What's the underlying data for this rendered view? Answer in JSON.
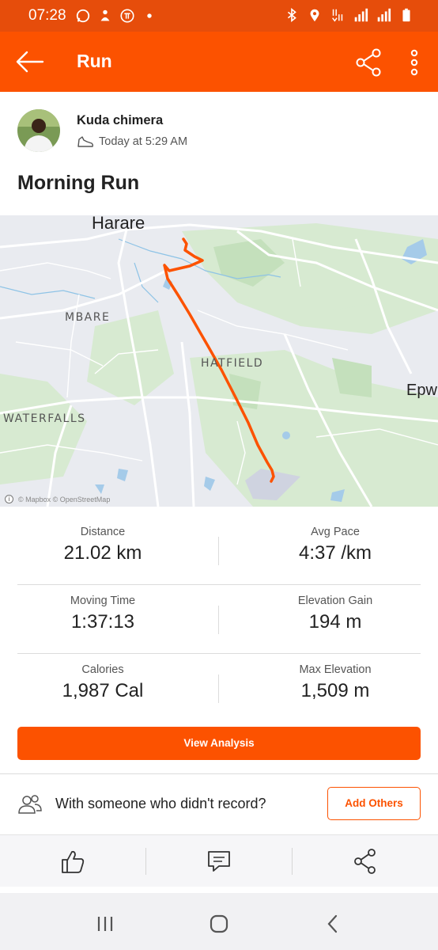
{
  "status_bar": {
    "time": "07:28"
  },
  "app_bar": {
    "title": "Run"
  },
  "athlete": {
    "name": "Kuda chimera",
    "time": "Today at 5:29 AM"
  },
  "activity": {
    "title": "Morning Run"
  },
  "map": {
    "labels": {
      "city": "Harare",
      "mbare": "MBARE",
      "hatfield": "HATFIELD",
      "waterfalls": "WATERFALLS",
      "east": "Epw"
    },
    "attribution": "© Mapbox © OpenStreetMap",
    "route_color": "#fc5200"
  },
  "stats": [
    {
      "label": "Distance",
      "value": "21.02 km"
    },
    {
      "label": "Avg Pace",
      "value": "4:37 /km"
    },
    {
      "label": "Moving Time",
      "value": "1:37:13"
    },
    {
      "label": "Elevation Gain",
      "value": "194 m"
    },
    {
      "label": "Calories",
      "value": "1,987 Cal"
    },
    {
      "label": "Max Elevation",
      "value": "1,509 m"
    }
  ],
  "analysis_button": "View Analysis",
  "with_others": {
    "text": "With someone who didn't record?",
    "button": "Add Others"
  },
  "actions": [
    "thumbs-up-icon",
    "comment-icon",
    "share-icon"
  ],
  "colors": {
    "brand": "#fc5200",
    "status_bar": "#e64d0b"
  }
}
